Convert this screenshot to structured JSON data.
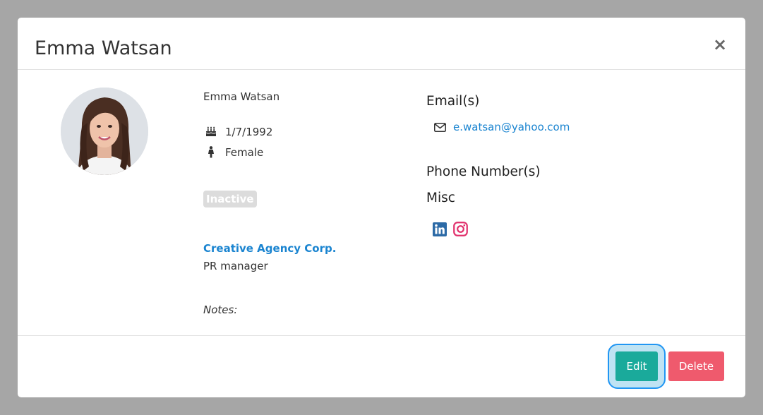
{
  "modal": {
    "title": "Emma Watsan",
    "close_label": "×"
  },
  "profile": {
    "name": "Emma Watsan",
    "dob": "1/7/1992",
    "gender": "Female",
    "status": "Inactive",
    "company": "Creative Agency Corp.",
    "job_title": "PR manager",
    "notes_label": "Notes:"
  },
  "contact": {
    "emails_heading": "Email(s)",
    "email": "e.watsan@yahoo.com",
    "phones_heading": "Phone Number(s)",
    "misc_heading": "Misc",
    "social_icons": [
      "linkedin-icon",
      "instagram-icon"
    ]
  },
  "footer": {
    "edit_label": "Edit",
    "delete_label": "Delete"
  },
  "colors": {
    "backdrop": "#a6a6a6",
    "link": "#1a84d0",
    "edit": "#1aaa9b",
    "delete": "#ef5a6d",
    "badge": "#dcdcdc",
    "linkedin": "#2c6aa6",
    "instagram": "#e1306c"
  }
}
